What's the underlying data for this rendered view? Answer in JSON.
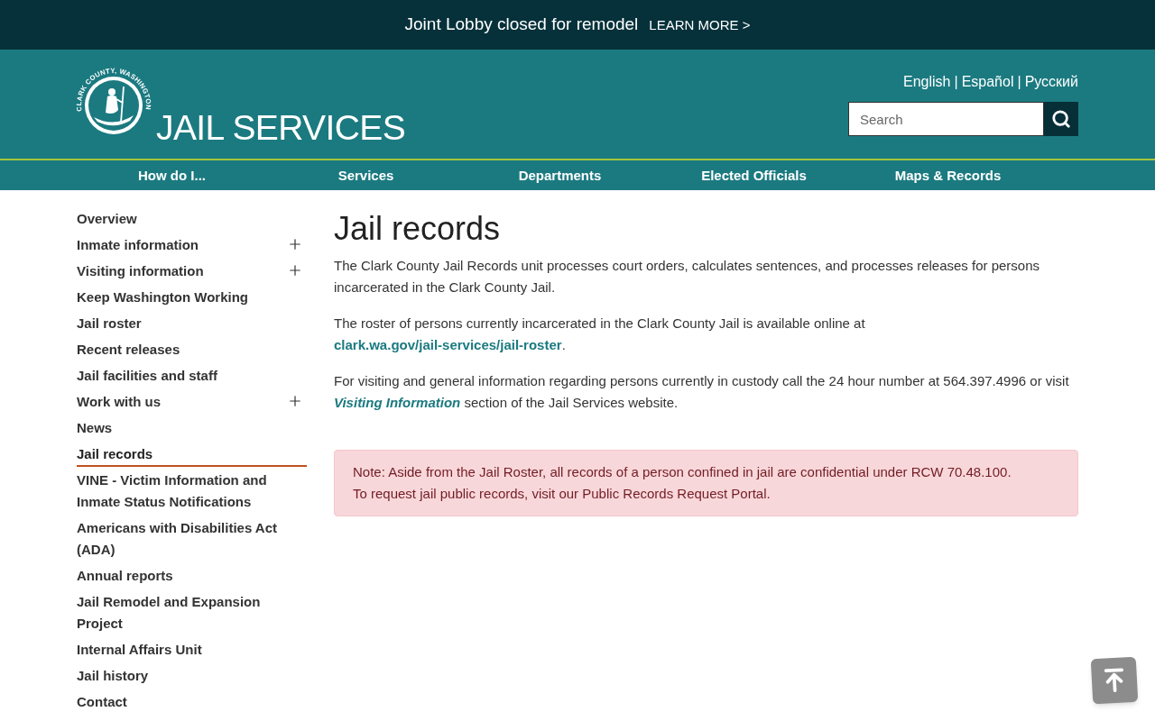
{
  "banner": {
    "message": "Joint Lobby closed for remodel",
    "link": "LEARN MORE >"
  },
  "header": {
    "logo_text": "CLARK COUNTY, WASHINGTON",
    "title": "JAIL SERVICES",
    "languages": [
      {
        "label": "English",
        "separator": "|"
      },
      {
        "label": "Español",
        "separator": "|"
      },
      {
        "label": "Русский"
      }
    ],
    "search": {
      "placeholder": "Search"
    }
  },
  "nav": {
    "items": [
      "How do I...",
      "Services",
      "Departments",
      "Elected Officials",
      "Maps & Records"
    ]
  },
  "sidebar": {
    "items": [
      {
        "label": "Overview",
        "kind": "page",
        "selected": false
      },
      {
        "label": "Inmate information",
        "kind": "group",
        "selected": false
      },
      {
        "label": "Visiting information",
        "kind": "group",
        "selected": false
      },
      {
        "label": "Keep Washington Working",
        "kind": "page",
        "selected": false
      },
      {
        "label": "Jail roster",
        "kind": "page",
        "selected": false
      },
      {
        "label": "Recent releases",
        "kind": "page",
        "selected": false
      },
      {
        "label": "Jail facilities and staff",
        "kind": "page",
        "selected": false
      },
      {
        "label": "Work with us",
        "kind": "group",
        "selected": false
      },
      {
        "label": "News",
        "kind": "page",
        "selected": false
      },
      {
        "label": "Jail records",
        "kind": "page",
        "selected": true
      },
      {
        "label": "VINE - Victim Information and Inmate Status Notifications",
        "kind": "page",
        "selected": false
      },
      {
        "label": "Americans with Disabilities Act (ADA)",
        "kind": "page",
        "selected": false
      },
      {
        "label": "Annual reports",
        "kind": "page",
        "selected": false
      },
      {
        "label": "Jail Remodel and Expansion Project",
        "kind": "page",
        "selected": false
      },
      {
        "label": "Internal Affairs Unit",
        "kind": "page",
        "selected": false
      },
      {
        "label": "Jail history",
        "kind": "page",
        "selected": false
      },
      {
        "label": "Contact",
        "kind": "page",
        "selected": false
      }
    ]
  },
  "main": {
    "title": "Jail records",
    "paragraphs": [
      {
        "parts": [
          {
            "kind": "text",
            "text": "The Clark County Jail Records unit processes court orders, calculates sentences, and processes releases for persons incarcerated in the Clark County Jail."
          }
        ]
      },
      {
        "parts": [
          {
            "kind": "text",
            "text": "The roster of persons currently incarcerated in the Clark County Jail is available online at "
          },
          {
            "kind": "link",
            "text": "clark.wa.gov/jail-services/jail-roster",
            "italic": false
          },
          {
            "kind": "text",
            "text": "."
          }
        ]
      },
      {
        "parts": [
          {
            "kind": "text",
            "text": "For visiting and general information regarding persons currently in custody call the 24 hour number at 564.397.4996 or visit "
          },
          {
            "kind": "link",
            "text": "Visiting Information",
            "italic": true
          },
          {
            "kind": "text",
            "text": " section of the Jail Services website."
          }
        ]
      }
    ],
    "alert": {
      "lines": [
        "Note: Aside from the Jail Roster, all records of a person confined in jail are confidential under RCW 70.48.100.",
        "To request jail public records, visit our Public Records Request Portal."
      ]
    }
  }
}
